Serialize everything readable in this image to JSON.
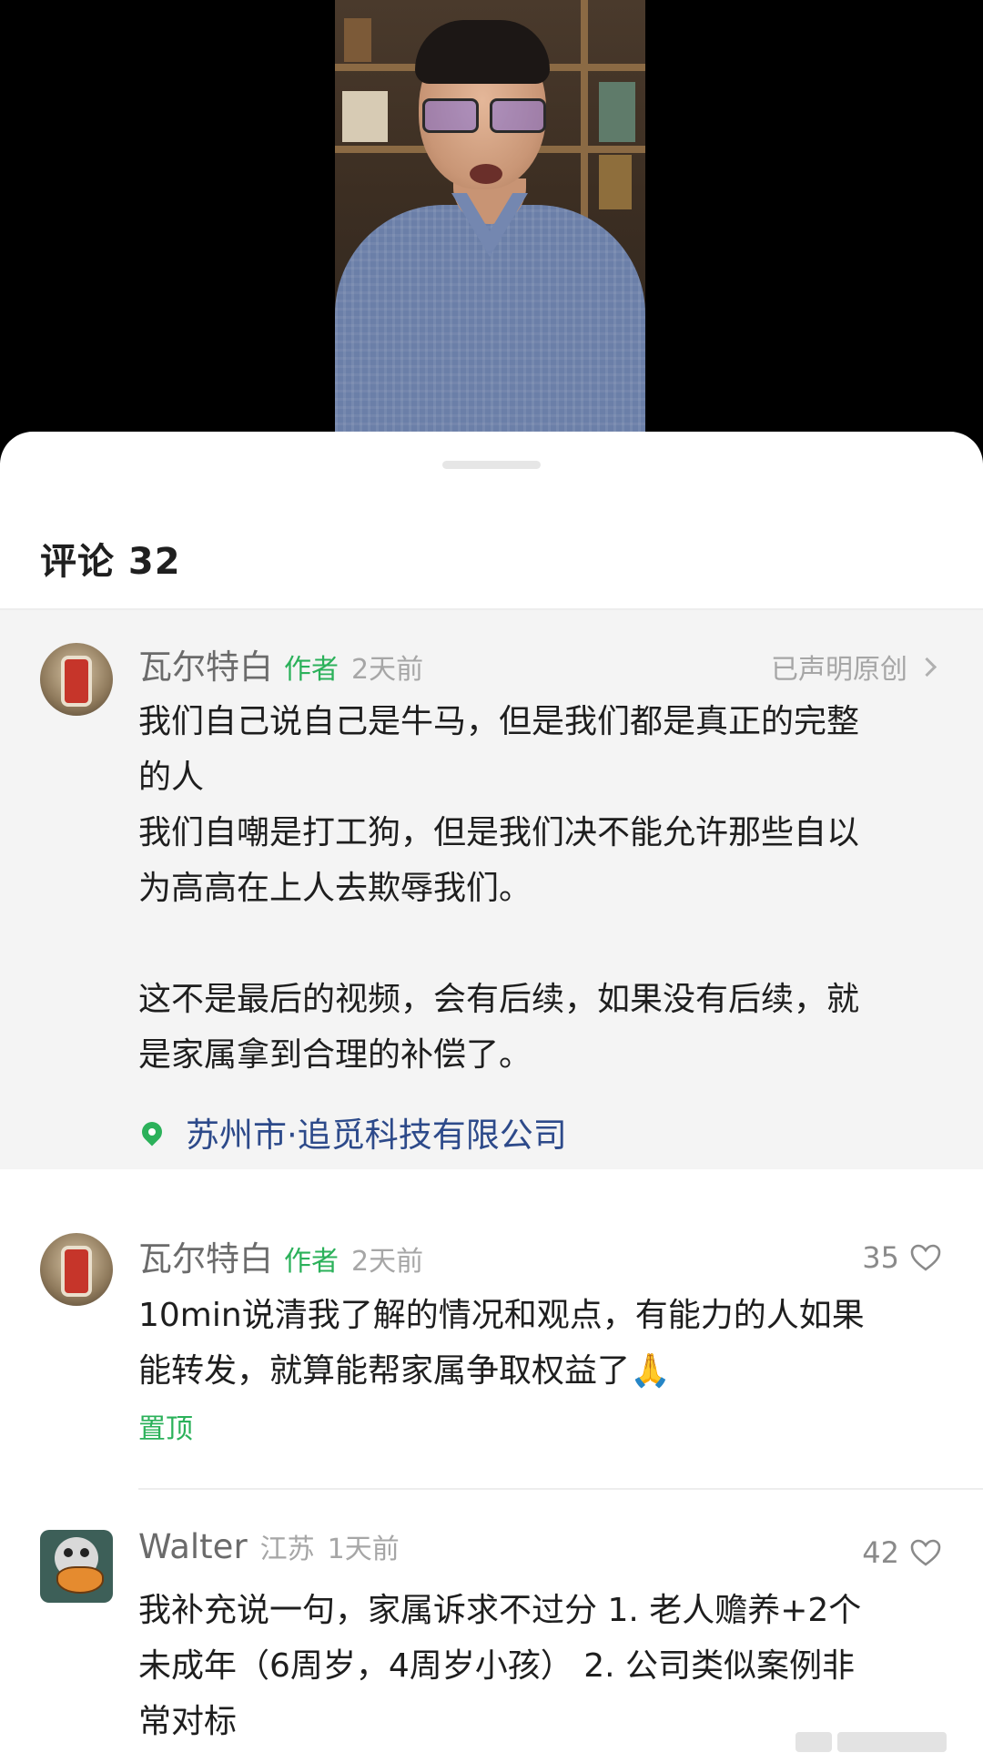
{
  "video": {
    "description_icon": "video-presenter"
  },
  "comments_header": {
    "label": "评论 32"
  },
  "pinned_post": {
    "author": "瓦尔特白",
    "author_tag": "作者",
    "time": "2天前",
    "original_claim": "已声明原创",
    "lines": [
      "我们自己说自己是牛马，但是我们都是真正的完整",
      "的人",
      "我们自嘲是打工狗，但是我们决不能允许那些自以",
      "为高高在上人去欺辱我们。",
      "",
      "这不是最后的视频，会有后续，如果没有后续，就",
      "是家属拿到合理的补偿了。"
    ],
    "location": "苏州市·追觅科技有限公司"
  },
  "comments": [
    {
      "author": "瓦尔特白",
      "author_tag": "作者",
      "time": "2天前",
      "likes": "35",
      "lines": [
        "10min说清我了解的情况和观点，有能力的人如果",
        "能转发，就算能帮家属争取权益了"
      ],
      "emoji": "🙏",
      "pin_label": "置顶"
    },
    {
      "author": "Walter",
      "region": "江苏",
      "time": "1天前",
      "likes": "42",
      "lines": [
        "我补充说一句，家属诉求不过分 1. 老人赡养+2个",
        "未成年（6周岁，4周岁小孩） 2. 公司类似案例非",
        "常对标"
      ]
    }
  ],
  "colors": {
    "accent_green": "#2bb15a",
    "location_blue": "#2d4a8a",
    "pinned_background": "#f4f4f4"
  }
}
